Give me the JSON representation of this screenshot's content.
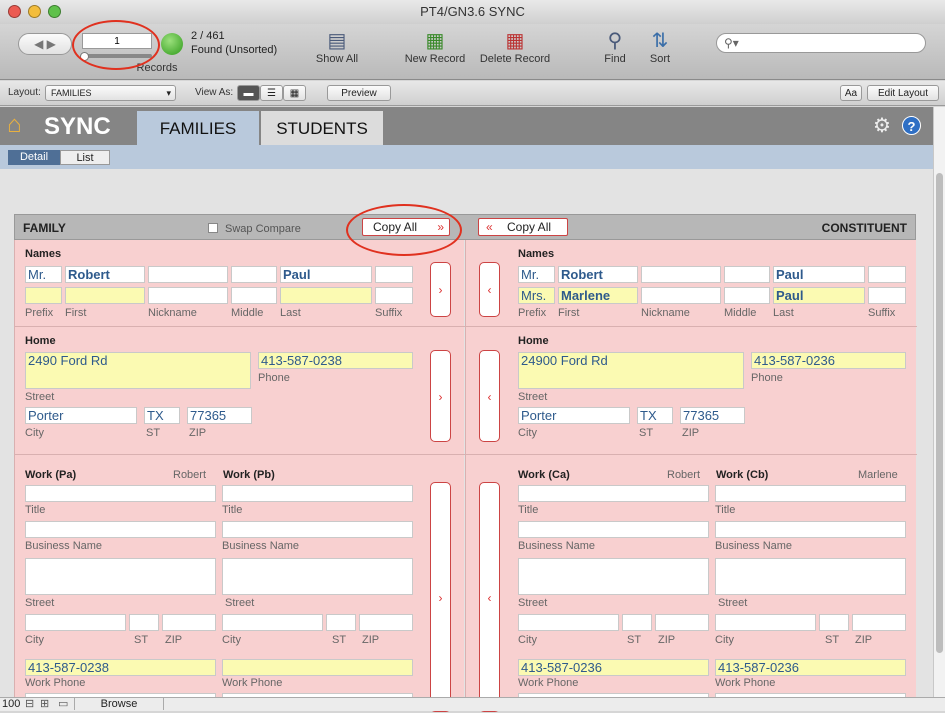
{
  "window": {
    "title": "PT4/GN3.6 SYNC"
  },
  "toolbar": {
    "record_input": "1",
    "records_label": "Records",
    "found_count": "2 / 461",
    "found_status": "Found (Unsorted)",
    "show_all": "Show All",
    "new_record": "New Record",
    "delete_record": "Delete Record",
    "find": "Find",
    "sort": "Sort",
    "search_placeholder": ""
  },
  "layoutbar": {
    "layout_label": "Layout:",
    "layout_value": "FAMILIES",
    "view_as_label": "View As:",
    "preview": "Preview",
    "aa": "Aa",
    "edit_layout": "Edit Layout"
  },
  "header": {
    "app_title": "SYNC",
    "tab_families": "FAMILIES",
    "tab_students": "STUDENTS",
    "sub_detail": "Detail",
    "sub_list": "List"
  },
  "panel": {
    "family_title": "FAMILY",
    "swap_compare": "Swap Compare",
    "copy_all": "Copy All",
    "constituent_title": "CONSTITUENT"
  },
  "labels": {
    "names": "Names",
    "prefix": "Prefix",
    "first": "First",
    "nickname": "Nickname",
    "middle": "Middle",
    "last": "Last",
    "suffix": "Suffix",
    "home": "Home",
    "street": "Street",
    "phone": "Phone",
    "city": "City",
    "st": "ST",
    "zip": "ZIP",
    "title": "Title",
    "business_name": "Business Name",
    "work_phone": "Work Phone",
    "work_pa": "Work (Pa)",
    "work_pb": "Work (Pb)",
    "work_ca": "Work (Ca)",
    "work_cb": "Work (Cb)"
  },
  "arrows": {
    "right": "›",
    "left": "‹"
  },
  "family": {
    "name1": {
      "prefix": "Mr.",
      "first": "Robert",
      "last": "Paul"
    },
    "home": {
      "street": "2490 Ford Rd",
      "phone": "413-587-0238",
      "city": "Porter",
      "st": "TX",
      "zip": "77365"
    },
    "work_a_name": "Robert",
    "work_a_phone": "413-587-0238"
  },
  "constituent": {
    "name1": {
      "prefix": "Mr.",
      "first": "Robert",
      "last": "Paul"
    },
    "name2": {
      "prefix": "Mrs.",
      "first": "Marlene",
      "last": "Paul"
    },
    "home": {
      "street": "24900 Ford Rd",
      "phone": "413-587-0236",
      "city": "Porter",
      "st": "TX",
      "zip": "77365"
    },
    "work_a_name": "Robert",
    "work_b_name": "Marlene",
    "work_a_phone": "413-587-0236",
    "work_b_phone": "413-587-0236"
  },
  "status": {
    "zoom": "100",
    "mode": "Browse"
  },
  "colors": {
    "highlight": "#fbfab2",
    "panel": "#f8d0d0",
    "annotation": "#e0311f",
    "tab_active": "#b9c9dc"
  }
}
